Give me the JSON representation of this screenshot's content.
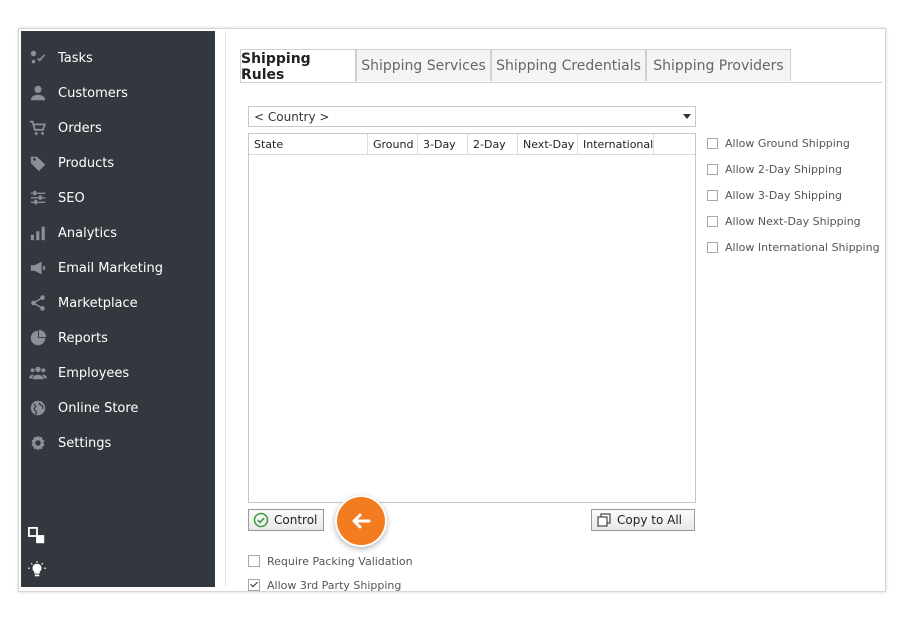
{
  "sidebar": {
    "items": [
      {
        "label": "Tasks",
        "icon": "tasks-icon"
      },
      {
        "label": "Customers",
        "icon": "user-icon"
      },
      {
        "label": "Orders",
        "icon": "cart-icon"
      },
      {
        "label": "Products",
        "icon": "tag-icon"
      },
      {
        "label": "SEO",
        "icon": "sliders-icon"
      },
      {
        "label": "Analytics",
        "icon": "bar-chart-icon"
      },
      {
        "label": "Email Marketing",
        "icon": "megaphone-icon"
      },
      {
        "label": "Marketplace",
        "icon": "share-icon"
      },
      {
        "label": "Reports",
        "icon": "pie-chart-icon"
      },
      {
        "label": "Employees",
        "icon": "group-icon"
      },
      {
        "label": "Online Store",
        "icon": "globe-icon"
      },
      {
        "label": "Settings",
        "icon": "gear-icon"
      }
    ],
    "bottom_icons": [
      "windows-icon",
      "lightbulb-icon"
    ]
  },
  "tabs": [
    {
      "label": "Shipping Rules",
      "active": true
    },
    {
      "label": "Shipping Services",
      "active": false
    },
    {
      "label": "Shipping Credentials",
      "active": false
    },
    {
      "label": "Shipping Providers",
      "active": false
    }
  ],
  "country_select": {
    "value": "< Country >"
  },
  "grid": {
    "columns": [
      "State",
      "Ground",
      "3-Day",
      "2-Day",
      "Next-Day",
      "International"
    ],
    "rows": []
  },
  "right_options": [
    {
      "label": "Allow Ground Shipping",
      "checked": false
    },
    {
      "label": "Allow 2-Day Shipping",
      "checked": false
    },
    {
      "label": "Allow 3-Day Shipping",
      "checked": false
    },
    {
      "label": "Allow Next-Day Shipping",
      "checked": false
    },
    {
      "label": "Allow International Shipping",
      "checked": false
    }
  ],
  "buttons": {
    "control": "Control",
    "copy_to_all": "Copy to All"
  },
  "bottom_options": [
    {
      "label": "Require Packing Validation",
      "checked": false
    },
    {
      "label": "Allow 3rd Party Shipping",
      "checked": true
    }
  ],
  "colors": {
    "sidebar_bg": "#33383f",
    "accent_orange": "#f47c20",
    "control_check_green": "#3a9a3a"
  }
}
